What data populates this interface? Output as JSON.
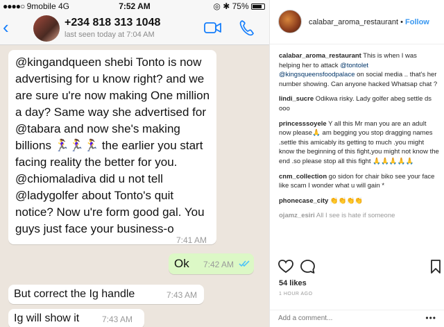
{
  "whatsapp": {
    "status_bar": {
      "carrier": "9mobile",
      "network": "4G",
      "time": "7:52 AM",
      "battery": "75%"
    },
    "header": {
      "back_icon": "chevron-left-icon",
      "contact": "+234 818 313 1048",
      "last_seen": "last seen today at 7:04 AM"
    },
    "messages": [
      {
        "direction": "incoming",
        "text": "@kingandqueen shebi Tonto is now advertising for u know right? and we are sure u're now making One million a day? Same way she advertised for @tabara and now she's making billions 🏃‍♀️🏃‍♀️🏃‍♀️ the earlier you start facing reality the better for you. @chiomaladiva did u not tell @ladygolfer about Tonto's quit notice? Now u're form good gal. You guys just face your business-o",
        "time": "7:41 AM"
      },
      {
        "direction": "outgoing",
        "text": "Ok",
        "time": "7:42 AM"
      },
      {
        "direction": "incoming",
        "text": "But correct the Ig handle",
        "time": "7:43 AM"
      },
      {
        "direction": "incoming",
        "text": "Ig will show it",
        "time": "7:43 AM"
      }
    ]
  },
  "instagram": {
    "username": "calabar_aroma_restaurant",
    "follow_label": "Follow",
    "caption": {
      "user": "calabar_aroma_restaurant",
      "text_before": " This is when I was helping her to attack ",
      "mention1": "@tontolet",
      "mention2": "@kingsqueensfoodpalace",
      "text_after": " on social media .. that's her number showing. Can anyone hacked Whatsap chat ?"
    },
    "comments": [
      {
        "user": "lindi_sucre",
        "text": " Odikwa risky. Lady golfer abeg settle ds ooo"
      },
      {
        "user": "princesssoyele",
        "text": " Y all this Mr man you are an adult now please🙏 am begging you stop dragging names .settle this amicably its getting to much .you might know the beginning of this fight,you might not know the end .so please stop all this fight 🙏🙏🙏🙏🙏"
      },
      {
        "user": "cnm_collection",
        "text": " go sidon for chair biko see your face like scam I wonder what u will gain *"
      },
      {
        "user": "phonecase_city",
        "text": " 👏👏👏👏"
      },
      {
        "user": "ojamz_esiri",
        "text": " All I see is hate if someone"
      }
    ],
    "likes": "54 likes",
    "posted_ago": "1 HOUR AGO",
    "comment_placeholder": "Add a comment...",
    "more_label": "•••"
  },
  "colors": {
    "whatsapp_bg": "#ece5dd",
    "outgoing_bubble": "#dcf8c6",
    "ios_blue": "#157efb",
    "ig_blue": "#3897f0"
  }
}
